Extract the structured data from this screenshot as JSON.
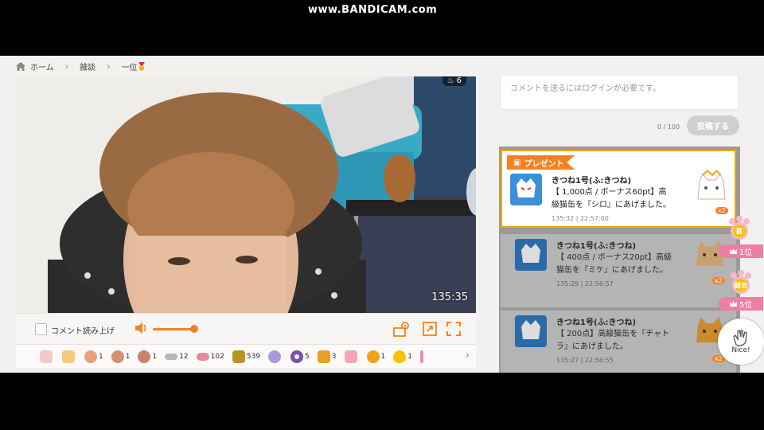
{
  "watermark": "www.BANDICAM.com",
  "breadcrumb": {
    "home": "ホーム",
    "category": "雑談",
    "current": "一位"
  },
  "video": {
    "viewers": "6",
    "time": "135:35"
  },
  "controls": {
    "read_aloud_label": "コメント読み上げ",
    "volume_percent": 95
  },
  "gifts": [
    {
      "name": "cake-icon",
      "count": "",
      "color": "#f3c9c9"
    },
    {
      "name": "bread-icon",
      "count": "",
      "color": "#f5c97a"
    },
    {
      "name": "face-icon-1",
      "count": "1",
      "color": "#e8a07a"
    },
    {
      "name": "face-icon-2",
      "count": "1",
      "color": "#d59070"
    },
    {
      "name": "face-icon-3",
      "count": "1",
      "color": "#c78468"
    },
    {
      "name": "fish-icon",
      "count": "12",
      "color": "#b0b8c0"
    },
    {
      "name": "food-bowl-icon",
      "count": "102",
      "color": "#e48aa0"
    },
    {
      "name": "cat-can-icon",
      "count": "539",
      "color": "#b8961e"
    },
    {
      "name": "yarn-icon",
      "count": "",
      "color": "#a99ad8"
    },
    {
      "name": "donut-icon",
      "count": "5",
      "color": "#7a4fb0"
    },
    {
      "name": "box-icon",
      "count": "3",
      "color": "#e6a022"
    },
    {
      "name": "pink-item-icon",
      "count": "",
      "color": "#f3a6b8"
    },
    {
      "name": "orange-ball-icon",
      "count": "1",
      "color": "#f2a11a"
    },
    {
      "name": "balloon-icon",
      "count": "1",
      "color": "#f5c400"
    },
    {
      "name": "stick-icon",
      "count": "",
      "color": "#f08cb0"
    }
  ],
  "comment": {
    "placeholder": "コメントを送るにはログインが必要です。",
    "counter": "0 / 100",
    "post_label": "投稿する"
  },
  "feed": {
    "present_tag": "プレゼント",
    "items": [
      {
        "user": "きつね1号(ふ:きつね)",
        "message": "【 1,000点 / ボーナス60pt】高級猫缶を『シロ』にあげました。",
        "time": "135:32 | 22:57:00",
        "multiplier": "x2",
        "goods_color": "#ffffff"
      },
      {
        "user": "きつね1号(ふ:きつね)",
        "message": "【 400点 / ボーナス20pt】高級猫缶を『ミケ』にあげました。",
        "time": "135:29 | 22:56:57",
        "multiplier": "x2",
        "goods_color": "#d8a860"
      },
      {
        "user": "きつね1号(ふ:きつね)",
        "message": "【 200点】高級猫缶を『チャトラ』にあげました。",
        "time": "135:27 | 22:56:55",
        "multiplier": "x2",
        "goods_color": "#e0a040"
      }
    ]
  },
  "ranks": {
    "b_label": "B",
    "b_rank": "1位",
    "total_label": "総合",
    "total_rank": "5位"
  },
  "nice_label": "Nice!",
  "colors": {
    "accent": "#f58220",
    "pink": "#ee7fa3",
    "gold": "#f0a500"
  }
}
